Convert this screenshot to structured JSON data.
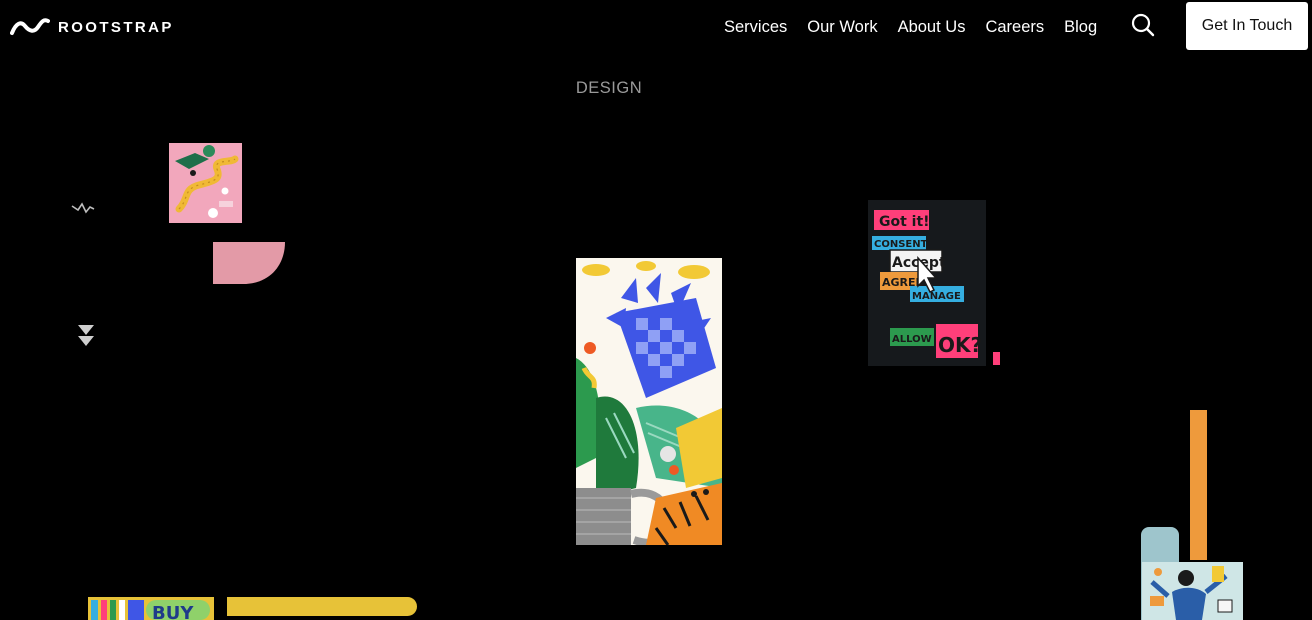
{
  "header": {
    "logo_text": "ROOTSTRAP",
    "nav": [
      {
        "label": "Services"
      },
      {
        "label": "Our Work"
      },
      {
        "label": "About Us"
      },
      {
        "label": "Careers"
      },
      {
        "label": "Blog"
      }
    ],
    "search_icon": "search-icon",
    "cta_label": "Get In Touch"
  },
  "section": {
    "label": "DESIGN"
  },
  "artwork": {
    "consent_card": {
      "labels": [
        "Got it!",
        "CONSENT",
        "Accept",
        "AGREE",
        "MANAGE",
        "ALLOW",
        "OK?"
      ]
    },
    "buy_label": "BUY"
  },
  "colors": {
    "background": "#000000",
    "text": "#ffffff",
    "label_gray": "#9a9a9a",
    "pink": "#e39aa7",
    "hot_pink": "#ff3f7a",
    "yellow": "#f2c935",
    "orange": "#ee9a3c",
    "blue": "#3f56e6",
    "teal_card": "#16191c",
    "cyan": "#35aee0",
    "light_teal": "#9ec5cc"
  }
}
